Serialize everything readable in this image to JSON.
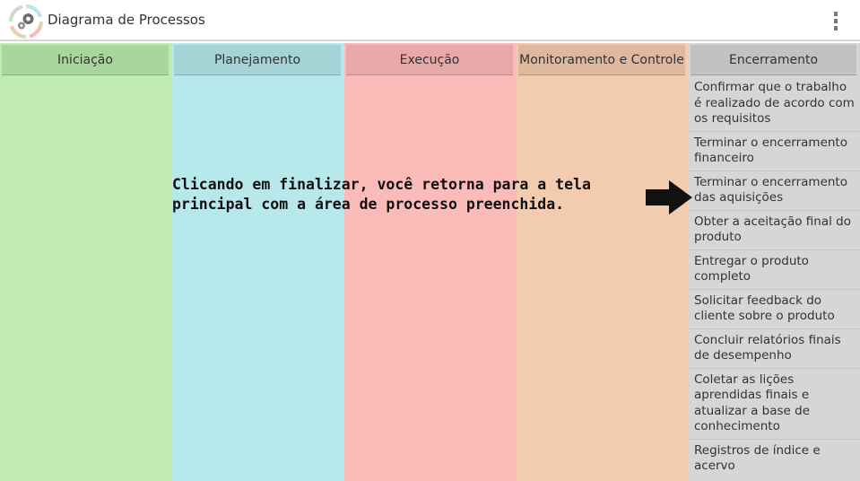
{
  "app": {
    "title": "Diagrama de Processos",
    "logo_icon": "gears-cycle-icon",
    "menu_icon": "overflow-menu-icon"
  },
  "columns": [
    {
      "id": "iniciacao",
      "label": "Iniciação",
      "color": "#bfeab2",
      "header_color": "#a9d69c"
    },
    {
      "id": "planejamento",
      "label": "Planejamento",
      "color": "#b7e8ec",
      "header_color": "#a5d3d6"
    },
    {
      "id": "execucao",
      "label": "Execução",
      "color": "#fbbcb9",
      "header_color": "#e6a9a7"
    },
    {
      "id": "monitoramento",
      "label": "Monitoramento e Controle",
      "color": "#f3cbaf",
      "header_color": "#deb89f"
    },
    {
      "id": "encerramento",
      "label": "Encerramento",
      "color": "#d6d6d6",
      "header_color": "#c2c2c2"
    }
  ],
  "encerramento_items": [
    "Confirmar que o trabalho é realizado de acordo com os requisitos",
    "Terminar o encerramento financeiro",
    "Terminar o encerramento das aquisições",
    "Obter a aceitação final do produto",
    "Entregar o produto completo",
    "Solicitar feedback do cliente sobre o produto",
    "Concluir relatórios finais de desempenho",
    "Coletar as lições aprendidas finais e atualizar a base de conhecimento",
    "Registros de índice e acervo"
  ],
  "annotation": {
    "line1": "Clicando em finalizar, você retorna para a tela",
    "line2": "principal com a área de processo preenchida.",
    "arrow_icon": "arrow-right-icon"
  }
}
